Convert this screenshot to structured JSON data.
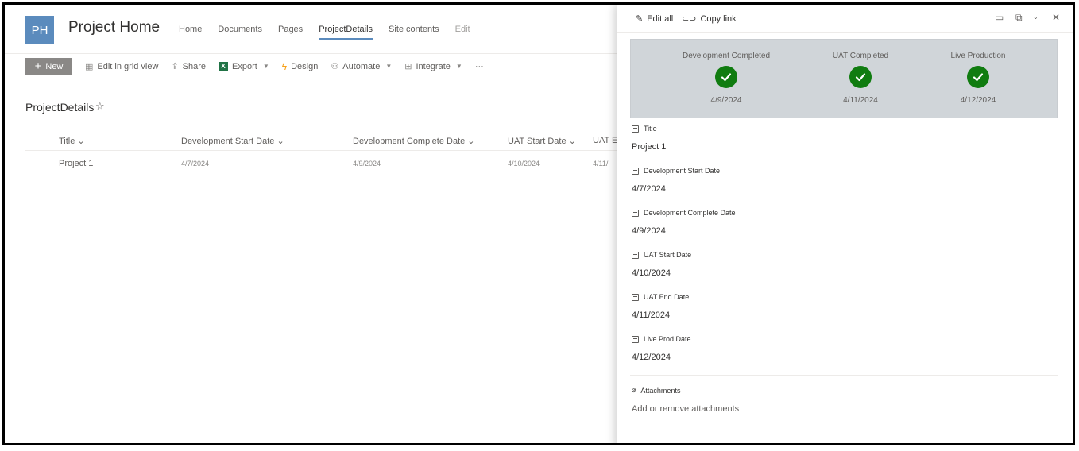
{
  "site": {
    "logo": "PH",
    "title": "Project Home",
    "nav": [
      "Home",
      "Documents",
      "Pages",
      "ProjectDetails",
      "Site contents",
      "Edit"
    ]
  },
  "commands": {
    "new": "New",
    "grid": "Edit in grid view",
    "share": "Share",
    "export": "Export",
    "design": "Design",
    "automate": "Automate",
    "integrate": "Integrate",
    "more": "···"
  },
  "list": {
    "title": "ProjectDetails",
    "columns": [
      "Title",
      "Development Start Date",
      "Development Complete Date",
      "UAT Start Date",
      "UAT Er"
    ],
    "rows": [
      {
        "title": "Project 1",
        "dev_start": "4/7/2024",
        "dev_complete": "4/9/2024",
        "uat_start": "4/10/2024",
        "uat_end": "4/11/"
      }
    ]
  },
  "panel": {
    "edit_all": "Edit all",
    "copy_link": "Copy link",
    "stages": [
      {
        "label": "Development Completed",
        "date": "4/9/2024"
      },
      {
        "label": "UAT Completed",
        "date": "4/11/2024"
      },
      {
        "label": "Live Production",
        "date": "4/12/2024"
      }
    ],
    "fields": [
      {
        "label": "Title",
        "value": "Project 1"
      },
      {
        "label": "Development Start Date",
        "value": "4/7/2024"
      },
      {
        "label": "Development Complete Date",
        "value": "4/9/2024"
      },
      {
        "label": "UAT Start Date",
        "value": "4/10/2024"
      },
      {
        "label": "UAT End Date",
        "value": "4/11/2024"
      },
      {
        "label": "Live Prod Date",
        "value": "4/12/2024"
      }
    ],
    "attachments_label": "Attachments",
    "attachments_action": "Add or remove attachments"
  },
  "colors": {
    "accent": "#5b8bbd",
    "success": "#107c10",
    "status_panel": "#d0d5d9"
  }
}
